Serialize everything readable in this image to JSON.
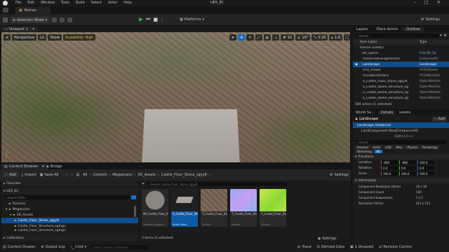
{
  "app": {
    "window_title": "UE5_EC"
  },
  "menu": [
    "File",
    "Edit",
    "Window",
    "Tools",
    "Build",
    "Select",
    "Actor",
    "Help"
  ],
  "document_tab": "Roman",
  "toolbar": {
    "selection_mode": "Selection Mode",
    "platforms": "Platforms",
    "settings": "Settings"
  },
  "viewport": {
    "tab": "Viewport 1",
    "perspective": "Perspective",
    "lit": "Lit",
    "show": "Show",
    "scalability": "Scalability: High",
    "grid_snap": "10",
    "rot_snap": "10°",
    "scale_snap": "0.25",
    "cam_speed": "1.6"
  },
  "content_browser": {
    "tab": "Content Browser",
    "bridge_tab": "Bridge",
    "add": "Add",
    "import": "Import",
    "save_all": "Save All",
    "path": [
      "All",
      "Content",
      "Megascans",
      "3D_Assets",
      "Castle_Floor_Stone_sgyy8"
    ],
    "settings": "Settings",
    "favorites": "Favorites",
    "project": "UE5_EC",
    "search_paths": "Search Paths",
    "search_assets": "Search Castle_Floor_Stone_sgyy8",
    "tree": [
      "Textures",
      "Megascans",
      "3D_Assets",
      "Castle_Floor_Stone_sgyy8",
      "Castle_Floor_Structure_sgmgu",
      "Castle_Floor_Structure_sgmgu"
    ],
    "collections": "Collections",
    "items_status": "5 items (1 selected)",
    "assets": [
      {
        "label": "MI_Castle_Floor_Stone_sgyy8_4K",
        "type": "Material Instance"
      },
      {
        "label": "S_Castle_Floor_Stone_sgyy8_lod0",
        "type": "Static Mesh"
      },
      {
        "label": "T_Castle_Floor_Stone_sgyy8_4K_D",
        "type": "Texture"
      },
      {
        "label": "T_Castle_Floor_Stone_sgyy8_4K_N",
        "type": "Texture"
      },
      {
        "label": "T_Castle_Floor_Stone_sgyy8_4K_DpR",
        "type": "Texture"
      }
    ]
  },
  "outliner": {
    "tabs": [
      "Layers",
      "Place Actors",
      "Outliner"
    ],
    "search": "Search...",
    "col_label": "Item Label",
    "col_type": "Type",
    "rows": [
      {
        "label": "Roman (Editor)",
        "type": ""
      },
      {
        "label": "BP_Spline",
        "type": "Edit BP_Sp"
      },
      {
        "label": "InstancedFoliageActor0",
        "type": "InstancedFo"
      },
      {
        "label": "Landscape",
        "type": "Landscape"
      },
      {
        "label": "PCG_Forest",
        "type": "PCGVolume"
      },
      {
        "label": "PCGWorldActor0",
        "type": "PCGWorldAct"
      },
      {
        "label": "S_Castle_Floor_Stone_sgyy8",
        "type": "StaticMeshAc"
      },
      {
        "label": "S_Castle_Stone_Structure_sg",
        "type": "StaticMeshAc"
      },
      {
        "label": "S_Castle_Stone_Structure_sg",
        "type": "StaticMeshAc"
      },
      {
        "label": "S_Castle_Stone_Structure_sg",
        "type": "StaticMeshAc"
      }
    ],
    "count": "584 actors (1 selected)"
  },
  "details": {
    "tabs": [
      "World Se...",
      "Details",
      "Levels"
    ],
    "actor": "Landscape",
    "add": "Add",
    "instance": "Landscape (Instance)",
    "root": "LandComponent (RootComponent0)",
    "edit_cpp": "Edit in C++",
    "search": "Search",
    "categories": [
      "General",
      "Actor",
      "LOD",
      "Misc",
      "Physics",
      "Rendering",
      "Streaming",
      "All"
    ],
    "transform": "Transform",
    "location": {
      "label": "Location",
      "x": "-600",
      "y": "-600",
      "z": "100.0"
    },
    "rotation": {
      "label": "Rotation",
      "x": "0.0",
      "y": "0.0",
      "z": "0.0"
    },
    "scale": {
      "label": "Scale",
      "x": "100.0",
      "y": "100.0",
      "z": "100.0"
    },
    "information": "Information",
    "info_rows": [
      {
        "label": "Component Resolution (Verts)",
        "value": "16 x 16"
      },
      {
        "label": "Component Count",
        "value": "100"
      },
      {
        "label": "Component Subsections",
        "value": "1 x 1"
      },
      {
        "label": "Resolution (Verts)",
        "value": "211 x 211"
      }
    ]
  },
  "status": {
    "content_drawer": "Content Drawer",
    "output_log": "Output Log",
    "cmd": "Cmd",
    "console_placeholder": "Enter Console Command",
    "trace": "Trace",
    "derived_data": "Derived Data",
    "unsaved": "1 Unsaved",
    "revision_control": "Revision Control"
  },
  "colors": {
    "accent": "#0e6fd0",
    "bg": "#1b1b1b",
    "play": "#3aa655"
  }
}
